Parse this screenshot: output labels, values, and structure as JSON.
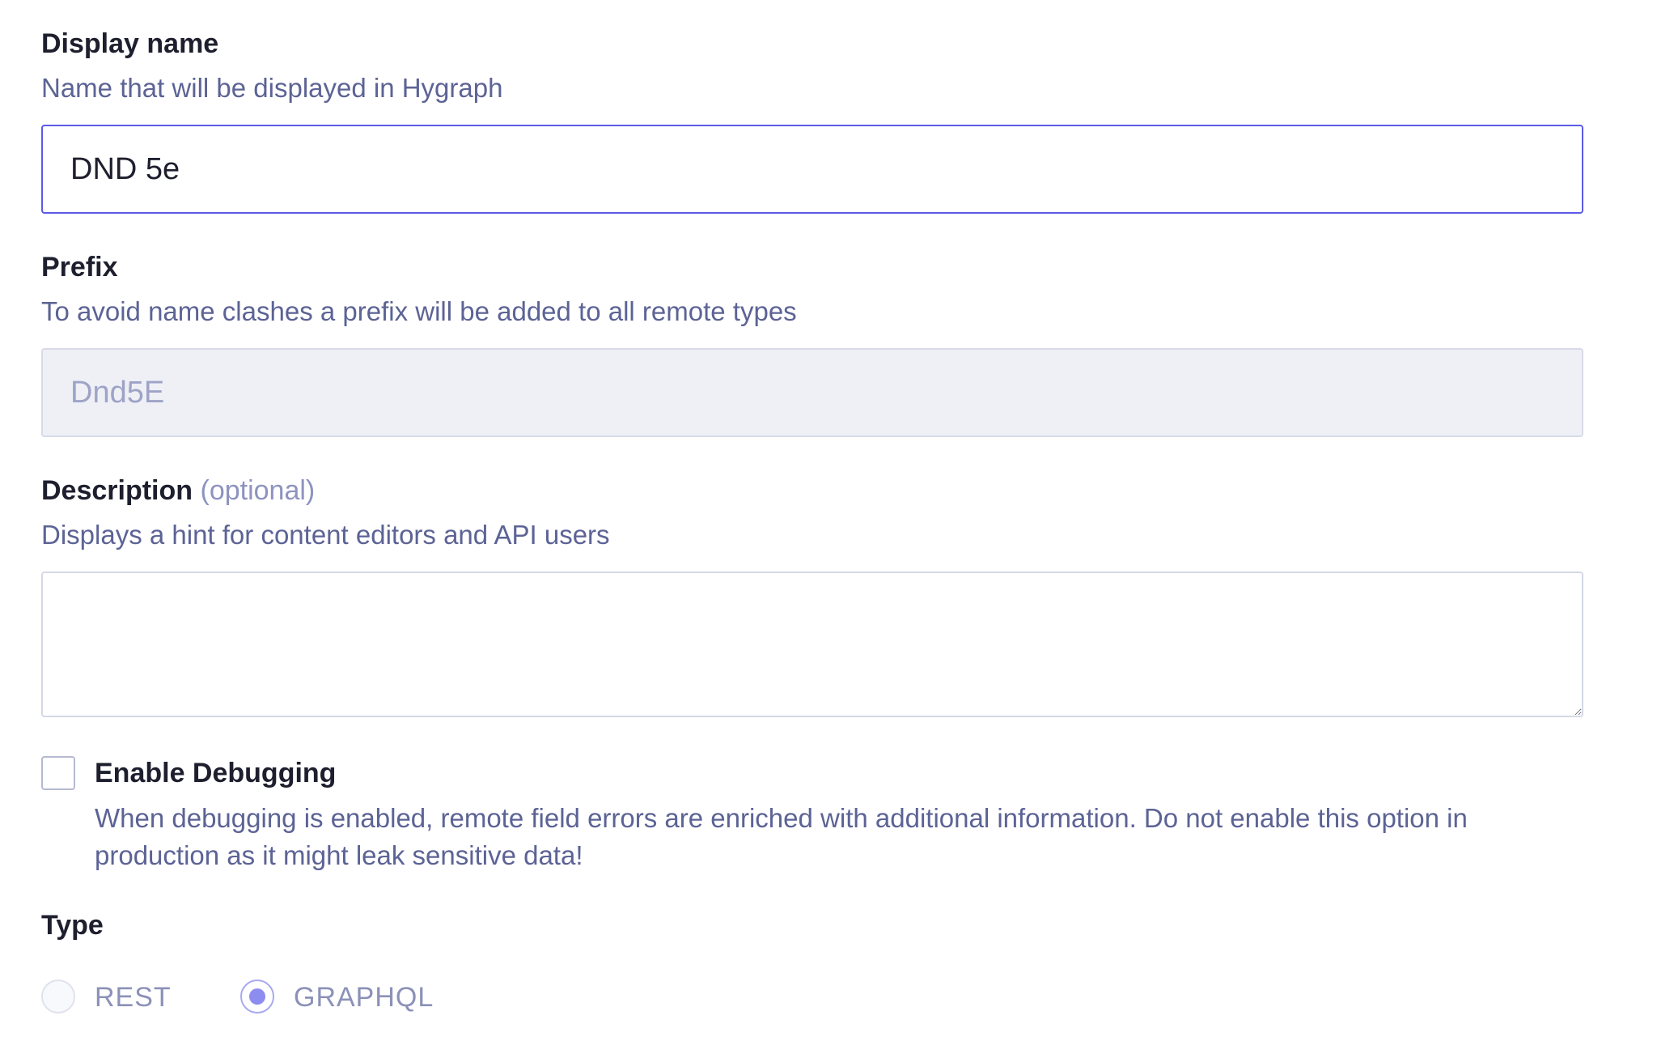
{
  "display_name": {
    "label": "Display name",
    "hint": "Name that will be displayed in Hygraph",
    "value": "DND 5e"
  },
  "prefix": {
    "label": "Prefix",
    "hint": "To avoid name clashes a prefix will be added to all remote types",
    "value": "Dnd5E"
  },
  "description": {
    "label": "Description",
    "optional": "(optional)",
    "hint": "Displays a hint for content editors and API users",
    "value": ""
  },
  "debugging": {
    "label": "Enable Debugging",
    "hint": "When debugging is enabled, remote field errors are enriched with additional information. Do not enable this option in production as it might leak sensitive data!",
    "checked": false
  },
  "type": {
    "label": "Type",
    "options": [
      {
        "label": "REST",
        "selected": false
      },
      {
        "label": "GRAPHQL",
        "selected": true
      }
    ]
  },
  "colors": {
    "accent": "#5b5be6",
    "hint_text": "#5c6395",
    "disabled_bg": "#eef0f5"
  }
}
